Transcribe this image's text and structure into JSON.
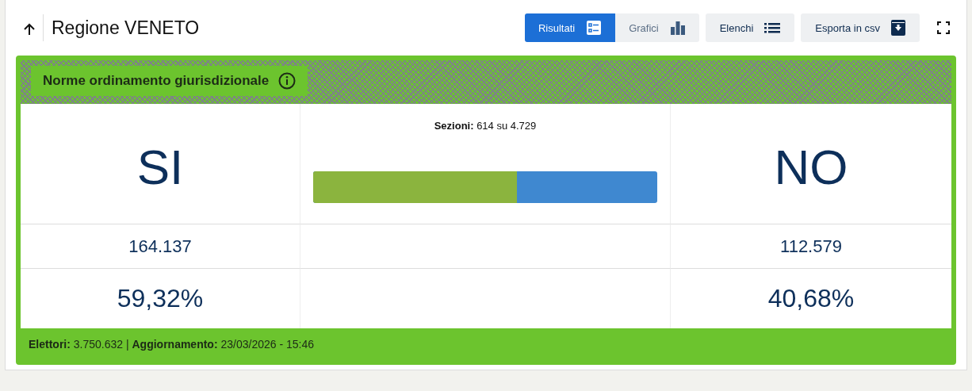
{
  "header": {
    "title": "Regione VENETO"
  },
  "view_tabs": [
    {
      "label": "Risultati",
      "selected": true,
      "kind": "table"
    },
    {
      "label": "Grafici",
      "selected": false,
      "kind": "chart"
    }
  ],
  "buttons": [
    {
      "label": "Elenchi",
      "kind": "list"
    },
    {
      "label": "Esporta in csv",
      "kind": "download"
    }
  ],
  "card": {
    "title": "Norme ordinamento giurisdizionale",
    "sections": "**Sezioni:** 614 su 4.729",
    "options": [
      {
        "label": "SI",
        "votes": "164.137",
        "percent": "59,32%",
        "color": "#8bb43e"
      },
      {
        "label": "NO",
        "votes": "112.579",
        "percent": "40,68%",
        "color": "#3f88d0"
      }
    ],
    "bar": {
      "level": 0.5932
    },
    "footer": "**Elettori:** 3.750.632 | **Aggiornamento:** 23/03/2026 - 15:46"
  }
}
